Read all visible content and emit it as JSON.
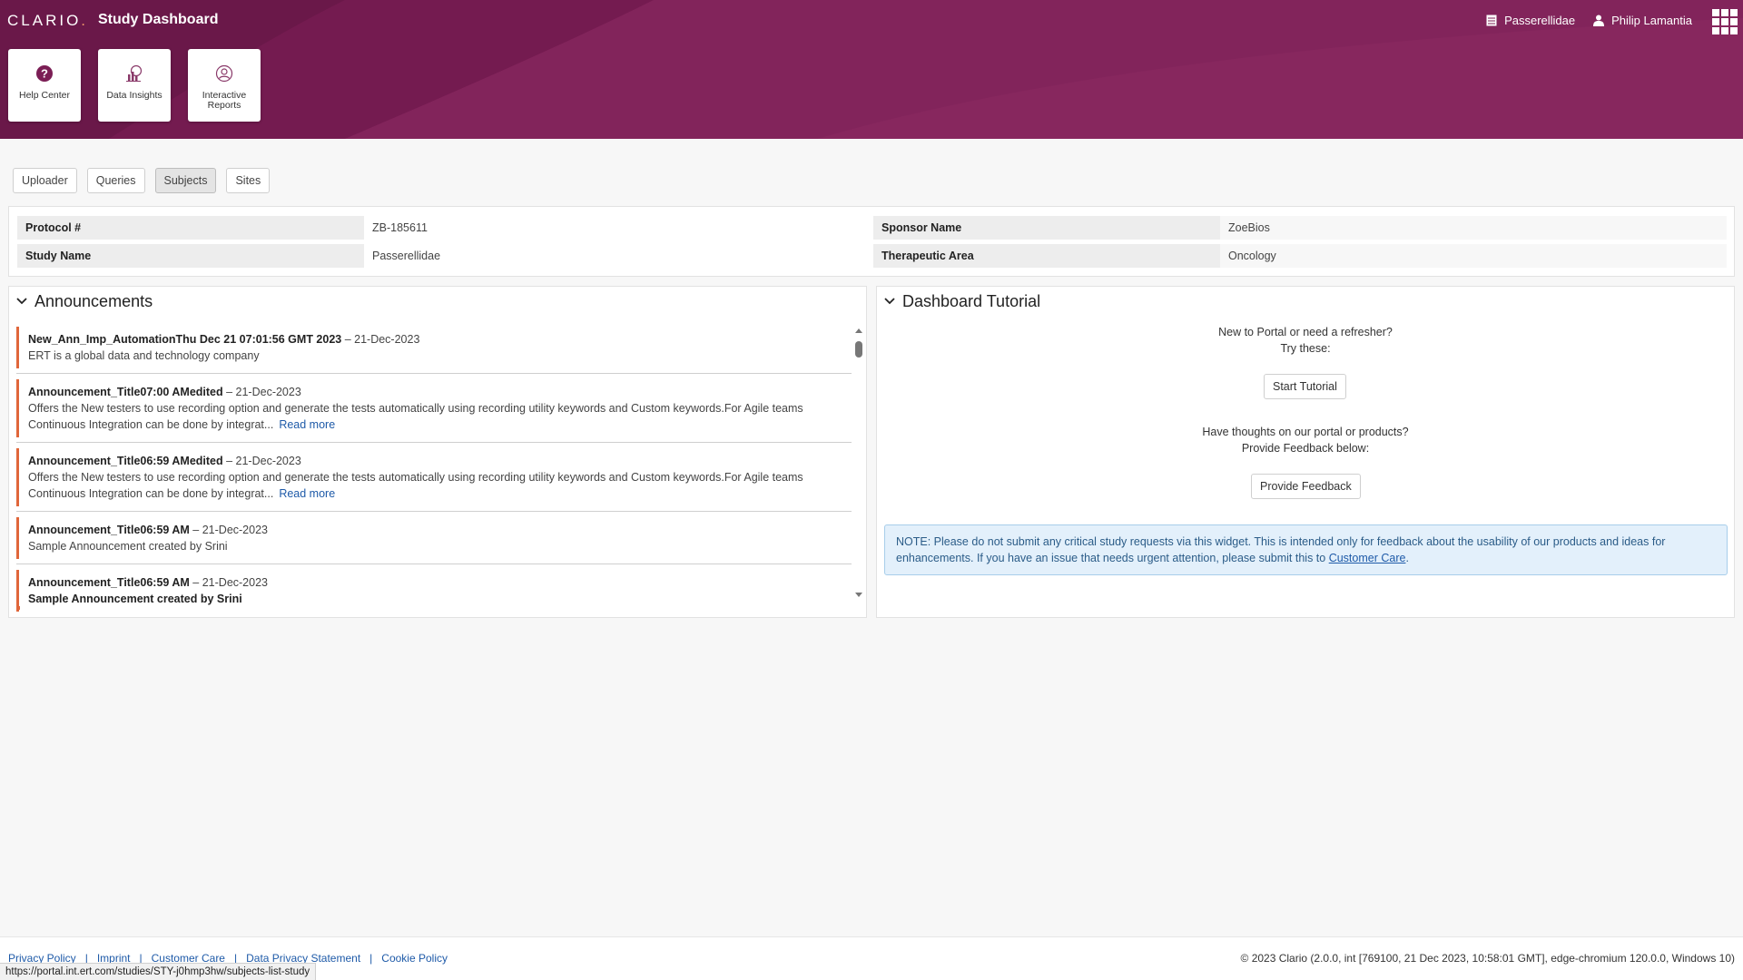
{
  "header": {
    "logo": "CLARIO",
    "logo_dot": ".",
    "title": "Study Dashboard",
    "study_selector": "Passerellidae",
    "user_name": "Philip Lamantia"
  },
  "tiles": [
    {
      "label": "Help Center",
      "icon": "question-circle-icon"
    },
    {
      "label": "Data Insights",
      "icon": "chart-icon"
    },
    {
      "label": "Interactive Reports",
      "icon": "reports-icon"
    }
  ],
  "tabs": [
    {
      "label": "Uploader",
      "active": false
    },
    {
      "label": "Queries",
      "active": false
    },
    {
      "label": "Subjects",
      "active": true
    },
    {
      "label": "Sites",
      "active": false
    }
  ],
  "study_info": {
    "protocol_label": "Protocol #",
    "protocol_value": "ZB-185611",
    "sponsor_label": "Sponsor Name",
    "sponsor_value": "ZoeBios",
    "study_name_label": "Study Name",
    "study_name_value": "Passerellidae",
    "therapeutic_label": "Therapeutic Area",
    "therapeutic_value": "Oncology"
  },
  "announcements": {
    "title": "Announcements",
    "items": [
      {
        "title": "New_Ann_Imp_AutomationThu Dec 21 07:01:56 GMT 2023",
        "date": " – 21-Dec-2023",
        "body": "ERT is a global data and technology company",
        "read_more": ""
      },
      {
        "title": "Announcement_Title07:00 AMedited",
        "date": " – 21-Dec-2023",
        "body": "Offers the New testers to use recording option and generate the tests automatically using recording utility keywords and Custom keywords.For Agile teams Continuous Integration can be done by integrat...",
        "read_more": "Read more"
      },
      {
        "title": "Announcement_Title06:59 AMedited",
        "date": " – 21-Dec-2023",
        "body": "Offers the New testers to use recording option and generate the tests automatically using recording utility keywords and Custom keywords.For Agile teams Continuous Integration can be done by integrat...",
        "read_more": "Read more"
      },
      {
        "title": "Announcement_Title06:59 AM",
        "date": " – 21-Dec-2023",
        "body": "Sample Announcement created by Srini",
        "read_more": ""
      },
      {
        "title": "Announcement_Title06:59 AM",
        "date": " – 21-Dec-2023",
        "body": "Sample Announcement created by Srini",
        "read_more": ""
      }
    ]
  },
  "tutorial": {
    "title": "Dashboard Tutorial",
    "line1": "New to Portal or need a refresher?",
    "line2": "Try these:",
    "start_button": "Start Tutorial",
    "line3": "Have thoughts on our portal or products?",
    "line4": "Provide Feedback below:",
    "feedback_button": "Provide Feedback",
    "note_text": "NOTE: Please do not submit any critical study requests via this widget. This is intended only for feedback about the usability of our products and ideas for enhancements. If you have an issue that needs urgent attention, please submit this to ",
    "note_link": "Customer Care",
    "note_end": "."
  },
  "footer": {
    "links": [
      "Privacy Policy",
      "Imprint",
      "Customer Care",
      "Data Privacy Statement",
      "Cookie Policy"
    ],
    "copyright": "© 2023 Clario (2.0.0, int [769100, 21 Dec 2023, 10:58:01 GMT], edge-chromium 120.0.0, Windows 10)"
  },
  "status_url": "https://portal.int.ert.com/studies/STY-j0hmp3hw/subjects-list-study",
  "colors": {
    "brand": "#7b1e55",
    "accent": "#e0663a",
    "link": "#1e5aa8"
  }
}
